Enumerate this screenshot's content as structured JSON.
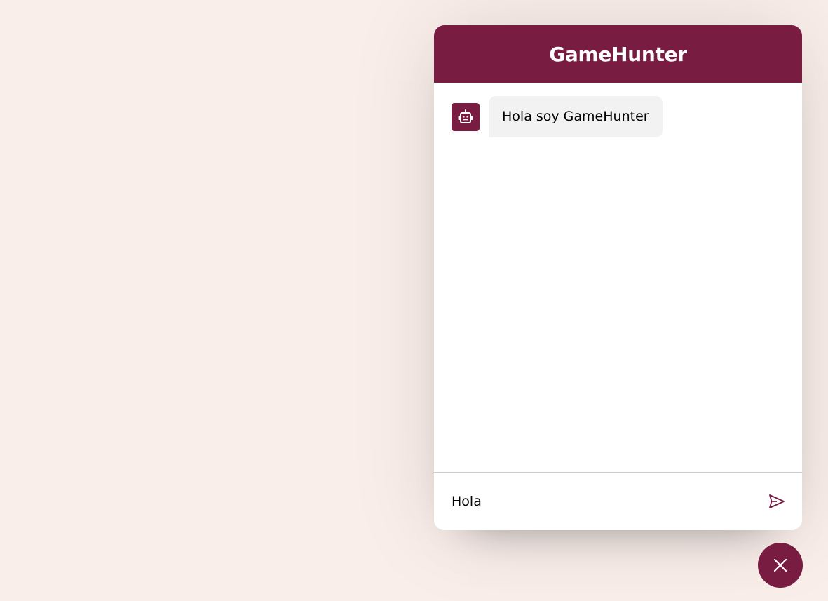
{
  "header": {
    "title": "GameHunter"
  },
  "chatbox": {
    "messages": [
      {
        "sender": "bot",
        "avatar_icon": "robot-icon",
        "text": "Hola soy GameHunter"
      }
    ]
  },
  "input": {
    "value": "Hola",
    "send_icon": "send-icon"
  },
  "toggler": {
    "icon": "close-icon"
  },
  "colors": {
    "accent": "#781c42",
    "background": "#f9eee9",
    "panel": "#ffffff",
    "bubble": "#f2f2f2",
    "divider": "#c9c9c9"
  }
}
